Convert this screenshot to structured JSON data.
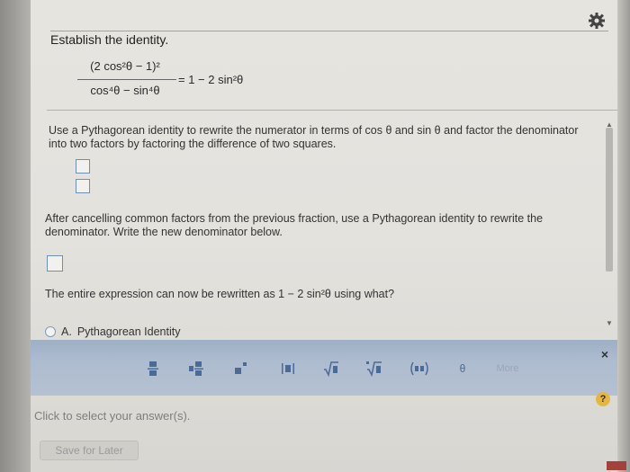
{
  "settings": {
    "icon": "gear-icon"
  },
  "header": {
    "title": "Establish the identity."
  },
  "identity": {
    "numerator": "(2 cos²θ − 1)²",
    "denominator": "cos⁴θ − sin⁴θ",
    "rhs": "= 1 − 2 sin²θ"
  },
  "instructions": {
    "step1": "Use a Pythagorean identity to rewrite the numerator in terms of cos θ and sin θ and factor the denominator into two factors by factoring the difference of two squares.",
    "step2": "After cancelling common factors from the previous fraction, use a Pythagorean identity to rewrite the denominator. Write the new denominator below.",
    "step3": "The entire expression can now be rewritten as 1 − 2 sin²θ using what?"
  },
  "options": [
    {
      "label": "A.",
      "text": "Pythagorean Identity"
    }
  ],
  "toolbar": {
    "buttons": [
      "fraction-icon",
      "mixed-number-icon",
      "exponent-icon",
      "absolute-value-icon",
      "sqrt-icon",
      "nth-root-icon",
      "parentheses-icon",
      "theta-icon"
    ],
    "more_label": "More",
    "close": "×"
  },
  "answer_prompt": "Click to select your answer(s).",
  "save_label": "Save for Later",
  "help": "?"
}
